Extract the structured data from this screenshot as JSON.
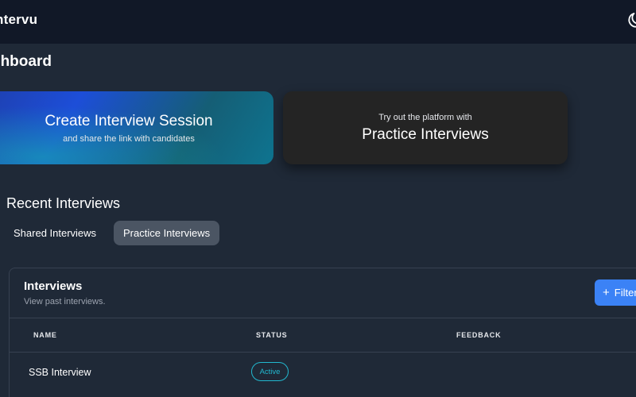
{
  "header": {
    "brand": "ntervu",
    "theme_toggle_icon": "moon-icon"
  },
  "page": {
    "title": "shboard"
  },
  "cards": {
    "create": {
      "title": "Create Interview Session",
      "subtitle": "and share the link with candidates"
    },
    "practice": {
      "pretitle": "Try out the platform with",
      "title": "Practice Interviews"
    }
  },
  "recent": {
    "title": "Recent Interviews",
    "tabs": [
      {
        "label": "Shared Interviews",
        "active": false
      },
      {
        "label": "Practice Interviews",
        "active": true
      }
    ]
  },
  "table": {
    "title": "Interviews",
    "subtitle": "View past interviews.",
    "filter_label": "Filter",
    "columns": [
      "NAME",
      "STATUS",
      "FEEDBACK"
    ],
    "rows": [
      {
        "name": "SSB Interview",
        "status": "Active",
        "feedback": ""
      }
    ]
  },
  "colors": {
    "background": "#1f2937",
    "topbar": "#111827",
    "accent": "#3b82f6",
    "status_active": "#22b8cf"
  }
}
